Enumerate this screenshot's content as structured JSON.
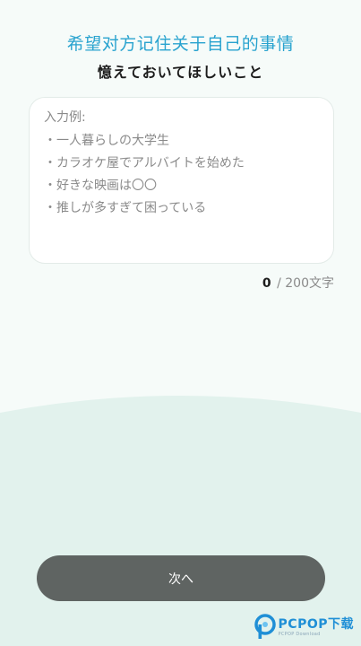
{
  "header": {
    "title_cn": "希望对方记住关于自己的事情",
    "title_jp": "憶えておいてほしいこと"
  },
  "memo": {
    "example_label": "入力例:",
    "examples": [
      "・一人暮らしの大学生",
      "・カラオケ屋でアルバイトを始めた",
      "・好きな映画は〇〇",
      "・推しが多すぎて困っている"
    ]
  },
  "counter": {
    "current": "0",
    "limit": " / 200文字"
  },
  "footer": {
    "next_label": "次へ"
  },
  "watermark": {
    "brand": "PCPOP下载",
    "sub": "PCPOP Download"
  },
  "colors": {
    "accent": "#29a3cf",
    "button": "#5f6462",
    "background": "#f6fbf9",
    "wave": "#e2f2ed"
  }
}
